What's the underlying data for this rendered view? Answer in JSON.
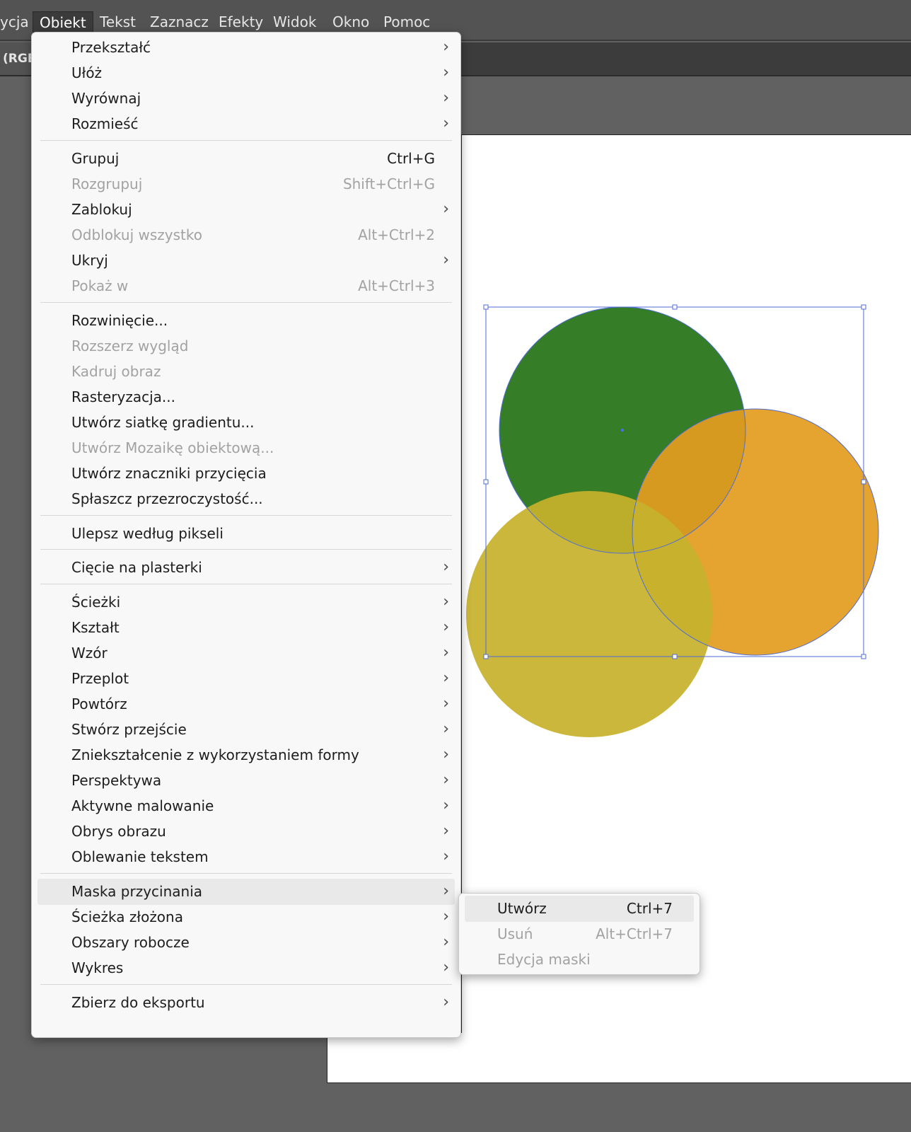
{
  "menubar": {
    "items": [
      {
        "label": "ycja"
      },
      {
        "label": "Obiekt",
        "active": true
      },
      {
        "label": "Tekst"
      },
      {
        "label": "Zaznacz"
      },
      {
        "label": "Efekty"
      },
      {
        "label": "Widok"
      },
      {
        "label": "Okno"
      },
      {
        "label": "Pomoc"
      }
    ]
  },
  "document_tab": {
    "label": "(RGB"
  },
  "obiekt_menu": {
    "items": [
      {
        "label": "Przekształć",
        "submenu": true
      },
      {
        "label": "Ułóż",
        "submenu": true
      },
      {
        "label": "Wyrównaj",
        "submenu": true
      },
      {
        "label": "Rozmieść",
        "submenu": true
      },
      {
        "label": "Grupuj",
        "shortcut": "Ctrl+G"
      },
      {
        "label": "Rozgrupuj",
        "shortcut": "Shift+Ctrl+G",
        "disabled": true
      },
      {
        "label": "Zablokuj",
        "submenu": true
      },
      {
        "label": "Odblokuj wszystko",
        "shortcut": "Alt+Ctrl+2",
        "disabled": true
      },
      {
        "label": "Ukryj",
        "submenu": true
      },
      {
        "label": "Pokaż w",
        "shortcut": "Alt+Ctrl+3",
        "disabled": true
      },
      {
        "label": "Rozwinięcie..."
      },
      {
        "label": "Rozszerz wygląd",
        "disabled": true
      },
      {
        "label": "Kadruj obraz",
        "disabled": true
      },
      {
        "label": "Rasteryzacja..."
      },
      {
        "label": "Utwórz siatkę gradientu..."
      },
      {
        "label": "Utwórz Mozaikę obiektową...",
        "disabled": true
      },
      {
        "label": "Utwórz znaczniki przycięcia"
      },
      {
        "label": "Spłaszcz przezroczystość..."
      },
      {
        "label": "Ulepsz według pikseli"
      },
      {
        "label": "Cięcie na plasterki",
        "submenu": true
      },
      {
        "label": "Ścieżki",
        "submenu": true
      },
      {
        "label": "Kształt",
        "submenu": true
      },
      {
        "label": "Wzór",
        "submenu": true
      },
      {
        "label": "Przeplot",
        "submenu": true
      },
      {
        "label": "Powtórz",
        "submenu": true
      },
      {
        "label": "Stwórz przejście",
        "submenu": true
      },
      {
        "label": "Zniekształcenie z wykorzystaniem formy",
        "submenu": true
      },
      {
        "label": "Perspektywa",
        "submenu": true
      },
      {
        "label": "Aktywne malowanie",
        "submenu": true
      },
      {
        "label": "Obrys obrazu",
        "submenu": true
      },
      {
        "label": "Oblewanie tekstem",
        "submenu": true
      },
      {
        "label": "Maska przycinania",
        "submenu": true,
        "highlighted": true
      },
      {
        "label": "Ścieżka złożona",
        "submenu": true
      },
      {
        "label": "Obszary robocze",
        "submenu": true
      },
      {
        "label": "Wykres",
        "submenu": true
      },
      {
        "label": "Zbierz do eksportu",
        "submenu": true
      }
    ]
  },
  "mask_submenu": {
    "items": [
      {
        "label": "Utwórz",
        "shortcut": "Ctrl+7",
        "highlighted": true
      },
      {
        "label": "Usuń",
        "shortcut": "Alt+Ctrl+7",
        "disabled": true
      },
      {
        "label": "Edycja maski",
        "disabled": true
      }
    ]
  },
  "artwork": {
    "circles": [
      {
        "name": "green-circle",
        "color": "#367d27"
      },
      {
        "name": "orange-circle",
        "color": "#e39c20"
      },
      {
        "name": "yellow-circle",
        "color": "#c6b12c"
      }
    ],
    "selection_color": "#4e6ed6"
  },
  "icons": {
    "submenu_arrow": "chevron-right-icon"
  }
}
